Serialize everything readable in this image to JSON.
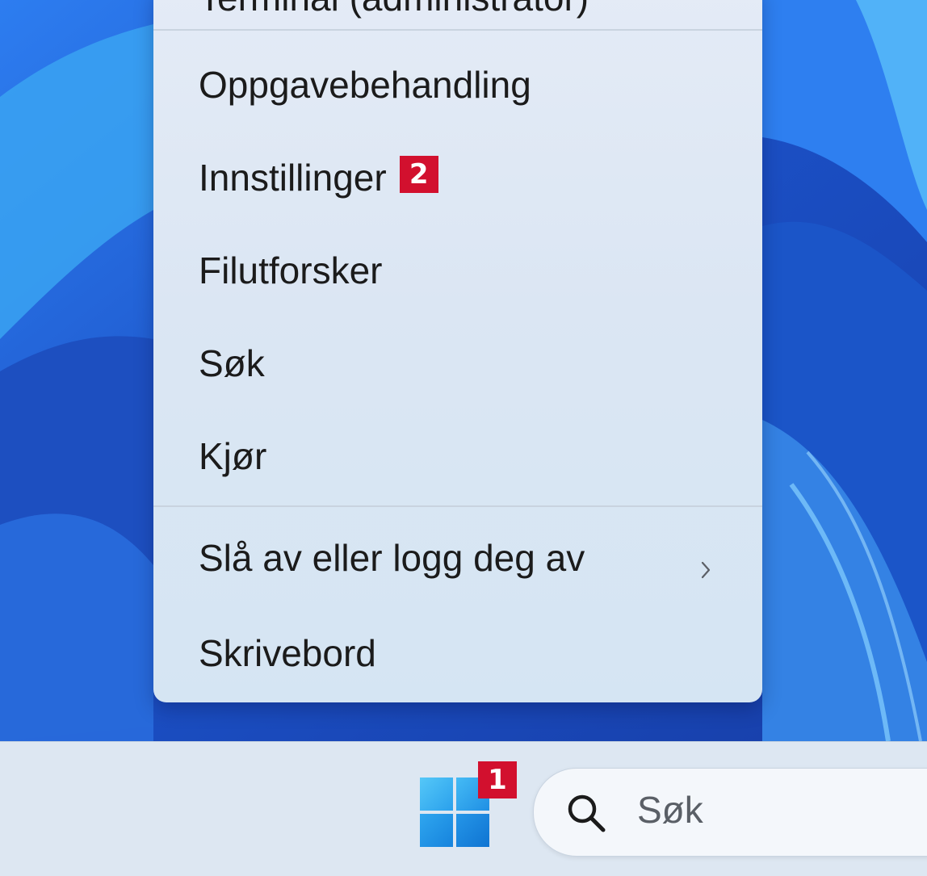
{
  "context_menu": {
    "cut_item_label": "Terminal (administrator)",
    "items": [
      {
        "label": "Oppgavebehandling"
      },
      {
        "label": "Innstillinger",
        "callout": "2"
      },
      {
        "label": "Filutforsker"
      },
      {
        "label": "Søk"
      },
      {
        "label": "Kjør"
      },
      {
        "label": "Slå av eller logg deg av",
        "submenu_icon": "chevron-right-icon"
      },
      {
        "label": "Skrivebord"
      }
    ]
  },
  "taskbar": {
    "start_callout": "1",
    "search_placeholder": "Søk"
  },
  "colors": {
    "callout": "#d2102e",
    "wallpaper": "#1f5fd6",
    "menu_bg": "#dde7f3"
  }
}
